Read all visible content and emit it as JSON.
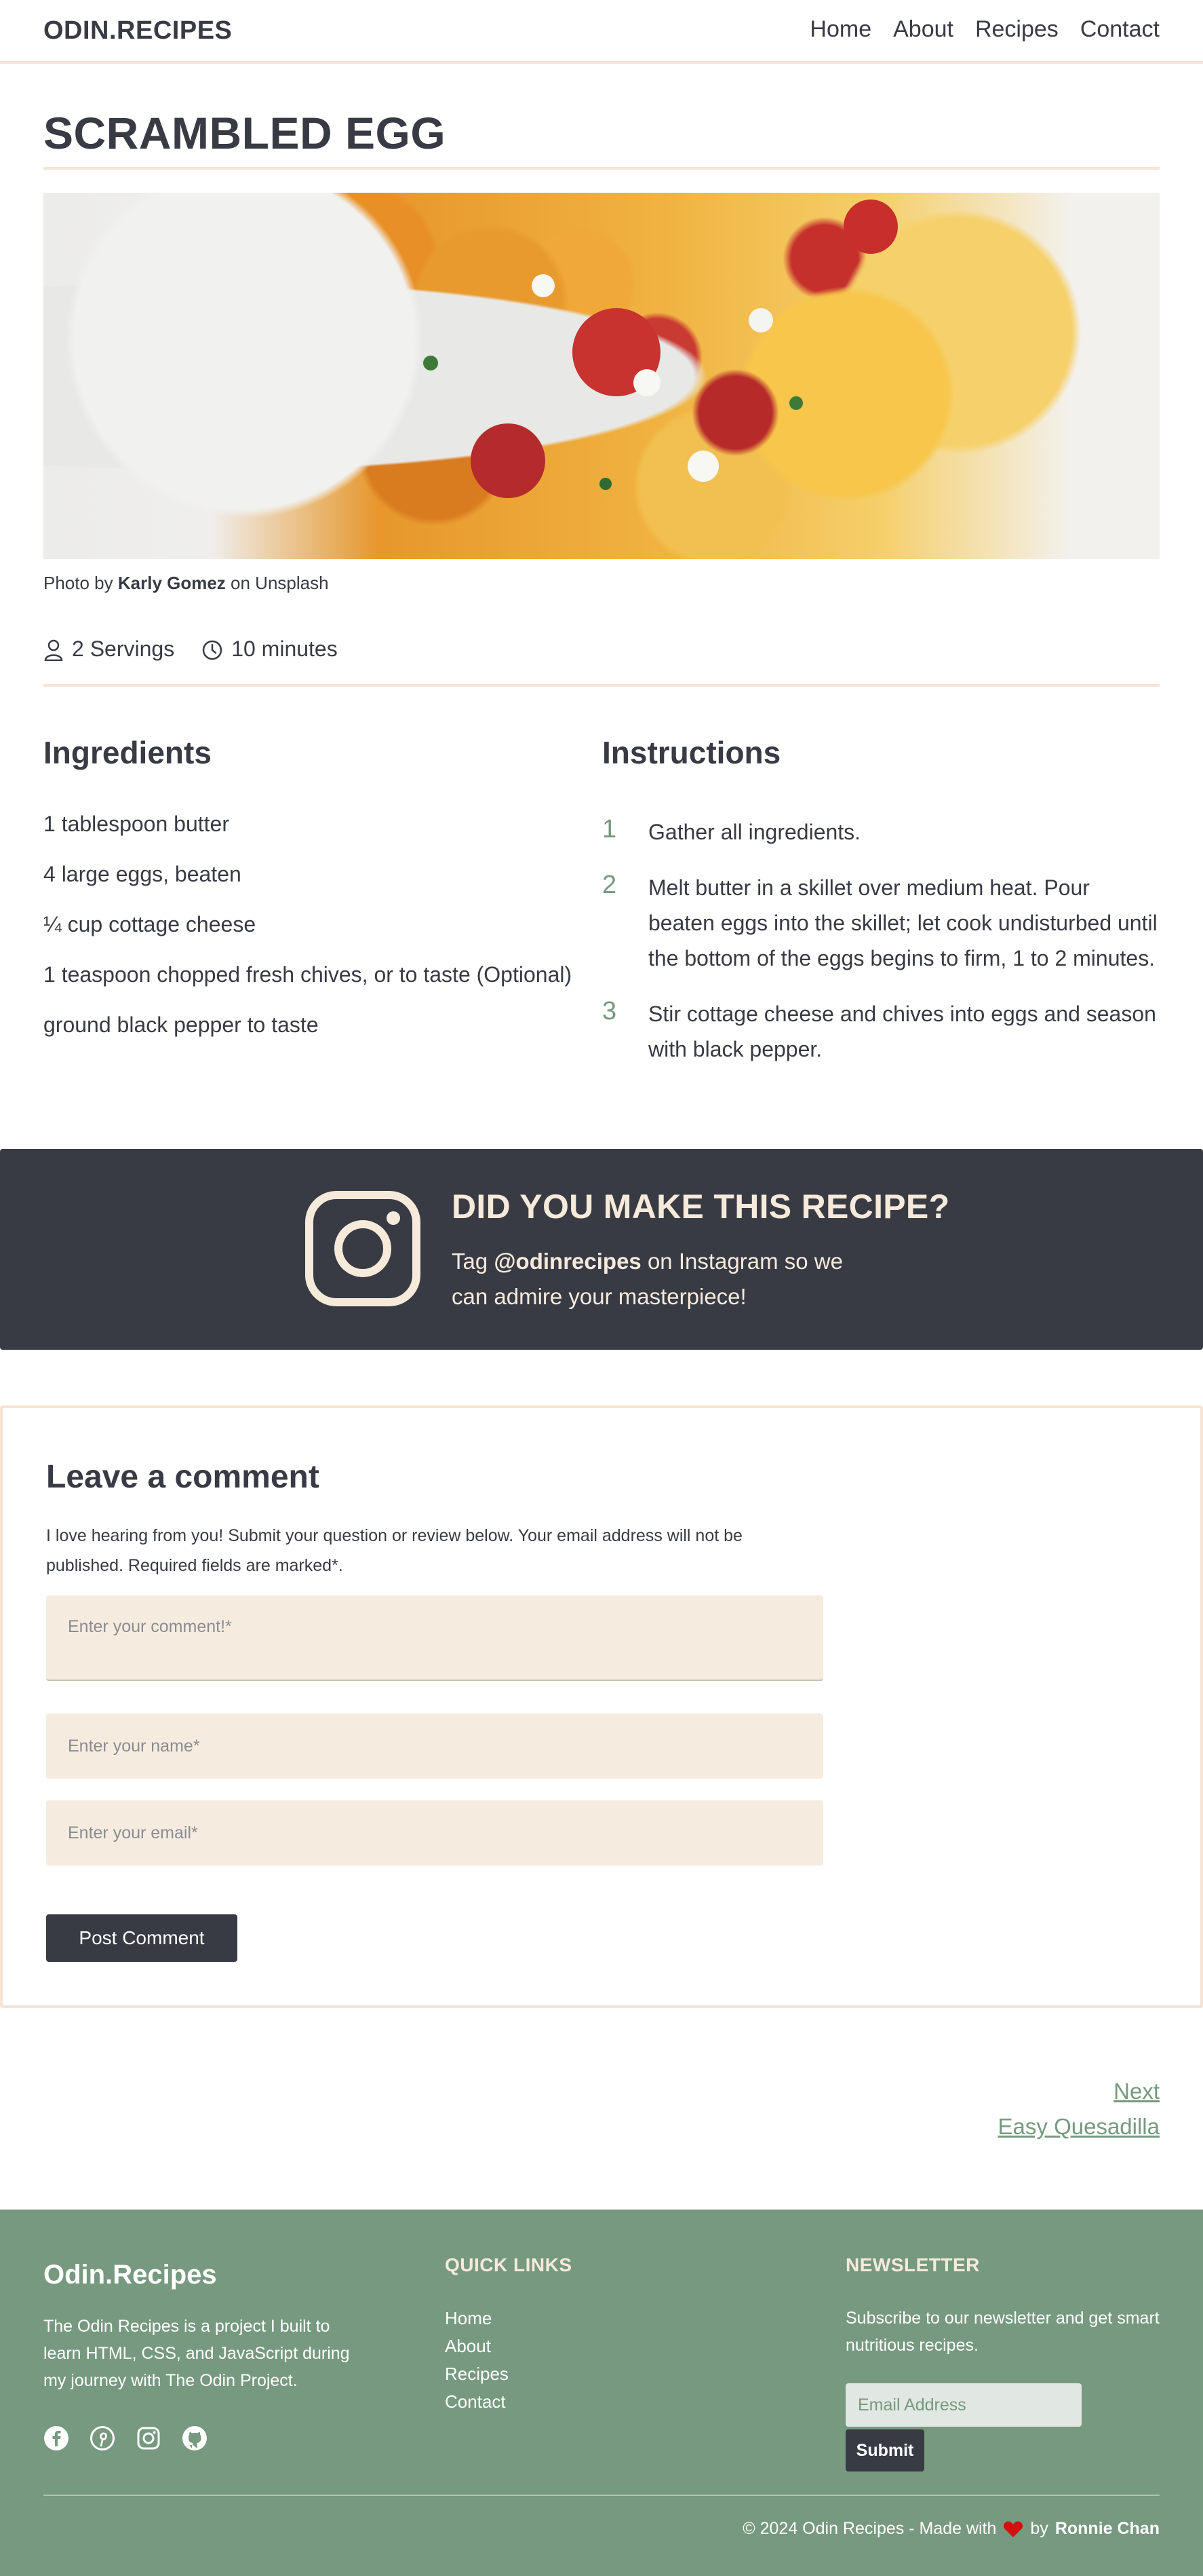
{
  "header": {
    "logo": "ODIN.RECIPES",
    "nav": [
      "Home",
      "About",
      "Recipes",
      "Contact"
    ]
  },
  "recipe": {
    "title": "SCRAMBLED EGG",
    "photo_caption": {
      "prefix": "Photo by ",
      "author": "Karly Gomez",
      "suffix": " on Unsplash"
    },
    "servings": "2 Servings",
    "time": "10 minutes",
    "ingredients_heading": "Ingredients",
    "ingredients": [
      "1 tablespoon butter",
      "4 large eggs, beaten",
      "¼ cup cottage cheese",
      "1 teaspoon chopped fresh chives, or to taste (Optional)",
      "ground black pepper to taste"
    ],
    "instructions_heading": "Instructions",
    "instructions": [
      {
        "num": "1",
        "text": "Gather all ingredients."
      },
      {
        "num": "2",
        "text": "Melt butter in a skillet over medium heat. Pour beaten eggs into the skillet; let cook undisturbed until the bottom of the eggs begins to firm, 1 to 2 minutes."
      },
      {
        "num": "3",
        "text": "Stir cottage cheese and chives into eggs and season with black pepper."
      }
    ]
  },
  "banner": {
    "heading": "DID YOU MAKE THIS RECIPE?",
    "text_prefix": "Tag ",
    "handle": "@odinrecipes",
    "text_suffix": " on Instagram so we can admire your masterpiece!"
  },
  "comment": {
    "heading": "Leave a comment",
    "intro": "I love hearing from you! Submit your question or review below. Your email address will not be published. Required fields are marked*.",
    "comment_placeholder": "Enter your comment!*",
    "name_placeholder": "Enter your name*",
    "email_placeholder": "Enter your email*",
    "submit_label": "Post Comment"
  },
  "next": {
    "label": "Next",
    "title": "Easy Quesadilla"
  },
  "footer": {
    "brand": "Odin.Recipes",
    "about": "The Odin Recipes is a project I built to learn HTML, CSS, and JavaScript during my journey with The Odin Project.",
    "socials": [
      "facebook-icon",
      "pinterest-icon",
      "instagram-icon",
      "github-icon"
    ],
    "quick_links_heading": "QUICK LINKS",
    "quick_links": [
      "Home",
      "About",
      "Recipes",
      "Contact"
    ],
    "newsletter_heading": "NEWSLETTER",
    "newsletter_text": "Subscribe to our newsletter and get smart nutritious recipes.",
    "email_placeholder": "Email Address",
    "submit_label": "Submit",
    "copyright_prefix": "© 2024 Odin Recipes - Made with",
    "copyright_by": "by",
    "author": "Ronnie Chan"
  },
  "colors": {
    "dark": "#383b44",
    "accent_green": "#76997f",
    "cream": "#f6eadb",
    "border_peach": "#f6e4d6",
    "field_bg": "#f5ecdf",
    "heart_red": "#d40f0f"
  }
}
